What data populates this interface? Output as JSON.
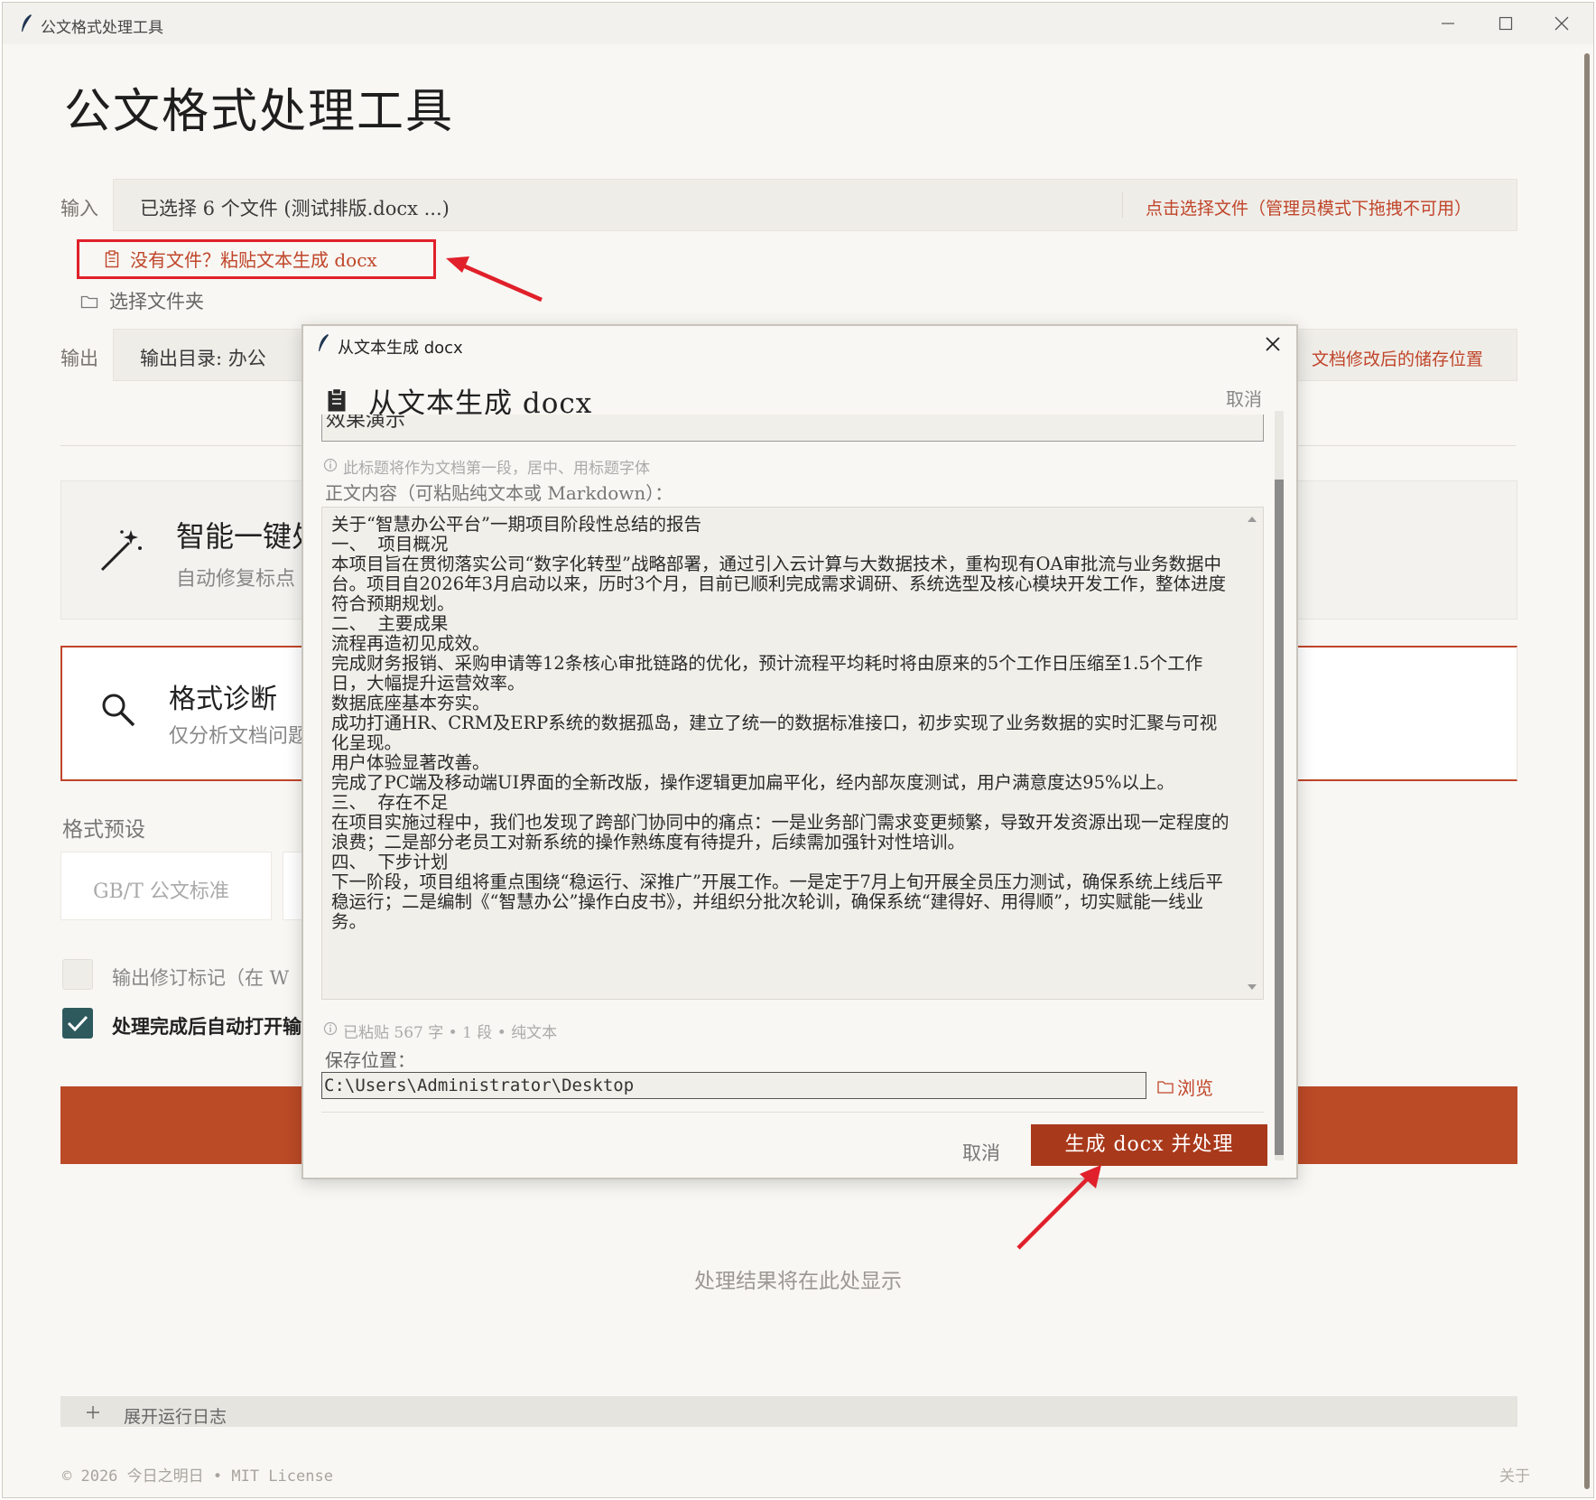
{
  "window": {
    "title": "公文格式处理工具"
  },
  "app_title": "公文格式处理工具",
  "input": {
    "label": "输入",
    "value": "已选择 6 个文件 (测试排版.docx ...)",
    "select_link": "点击选择文件（管理员模式下拖拽不可用）",
    "paste_link": "没有文件？粘贴文本生成 docx",
    "folder_link": "选择文件夹"
  },
  "output": {
    "label": "输出",
    "value": "输出目录: 办公",
    "hint": "文档修改后的储存位置"
  },
  "cards": {
    "smart": {
      "title": "智能一键处",
      "sub": "自动修复标点"
    },
    "diag": {
      "title": "格式诊断",
      "sub": "仅分析文档问题"
    }
  },
  "presets": {
    "section": "格式预设",
    "items": [
      "GB/T 公文标准"
    ]
  },
  "options": {
    "revision": {
      "label": "输出修订标记（在 W",
      "checked": false
    },
    "auto_open": {
      "label": "处理完成后自动打开输",
      "checked": true
    }
  },
  "result_hint": "处理结果将在此处显示",
  "log_toggle": "展开运行日志",
  "footer": {
    "copyright": "© 2026 今日之明日 • MIT License",
    "about": "关于"
  },
  "dialog": {
    "window_title": "从文本生成 docx",
    "heading": "从文本生成 docx",
    "cancel_top": "取消",
    "title_value": "效果演示",
    "title_hint": "此标题将作为文档第一段，居中、用标题字体",
    "body_label": "正文内容（可粘贴纯文本或 Markdown）：",
    "body_text": "关于“智慧办公平台”一期项目阶段性总结的报告\n一、  项目概况\n本项目旨在贯彻落实公司“数字化转型”战略部署，通过引入云计算与大数据技术，重构现有OA审批流与业务数据中台。项目自2026年3月启动以来，历时3个月，目前已顺利完成需求调研、系统选型及核心模块开发工作，整体进度符合预期规划。\n二、  主要成果\n流程再造初见成效。\n完成财务报销、采购申请等12条核心审批链路的优化，预计流程平均耗时将由原来的5个工作日压缩至1.5个工作日，大幅提升运营效率。\n数据底座基本夯实。\n成功打通HR、CRM及ERP系统的数据孤岛，建立了统一的数据标准接口，初步实现了业务数据的实时汇聚与可视化呈现。\n用户体验显著改善。\n完成了PC端及移动端UI界面的全新改版，操作逻辑更加扁平化，经内部灰度测试，用户满意度达95%以上。\n三、  存在不足\n在项目实施过程中，我们也发现了跨部门协同中的痛点：一是业务部门需求变更频繁，导致开发资源出现一定程度的浪费；二是部分老员工对新系统的操作熟练度有待提升，后续需加强针对性培训。\n四、  下步计划\n下一阶段，项目组将重点围绕“稳运行、深推广”开展工作。一是定于7月上旬开展全员压力测试，确保系统上线后平稳运行；二是编制《“智慧办公”操作白皮书》，并组织分批次轮训，确保系统“建得好、用得顺”，切实赋能一线业务。",
    "stats": "已粘贴 567 字 • 1 段 • 纯文本",
    "save_label": "保存位置：",
    "save_path": "C:\\Users\\Administrator\\Desktop",
    "browse": "浏览",
    "cancel": "取消",
    "generate": "生成 docx 并处理"
  },
  "colors": {
    "accent": "#bb4a27",
    "annotation": "#e0202a",
    "check": "#2e5a5e"
  }
}
